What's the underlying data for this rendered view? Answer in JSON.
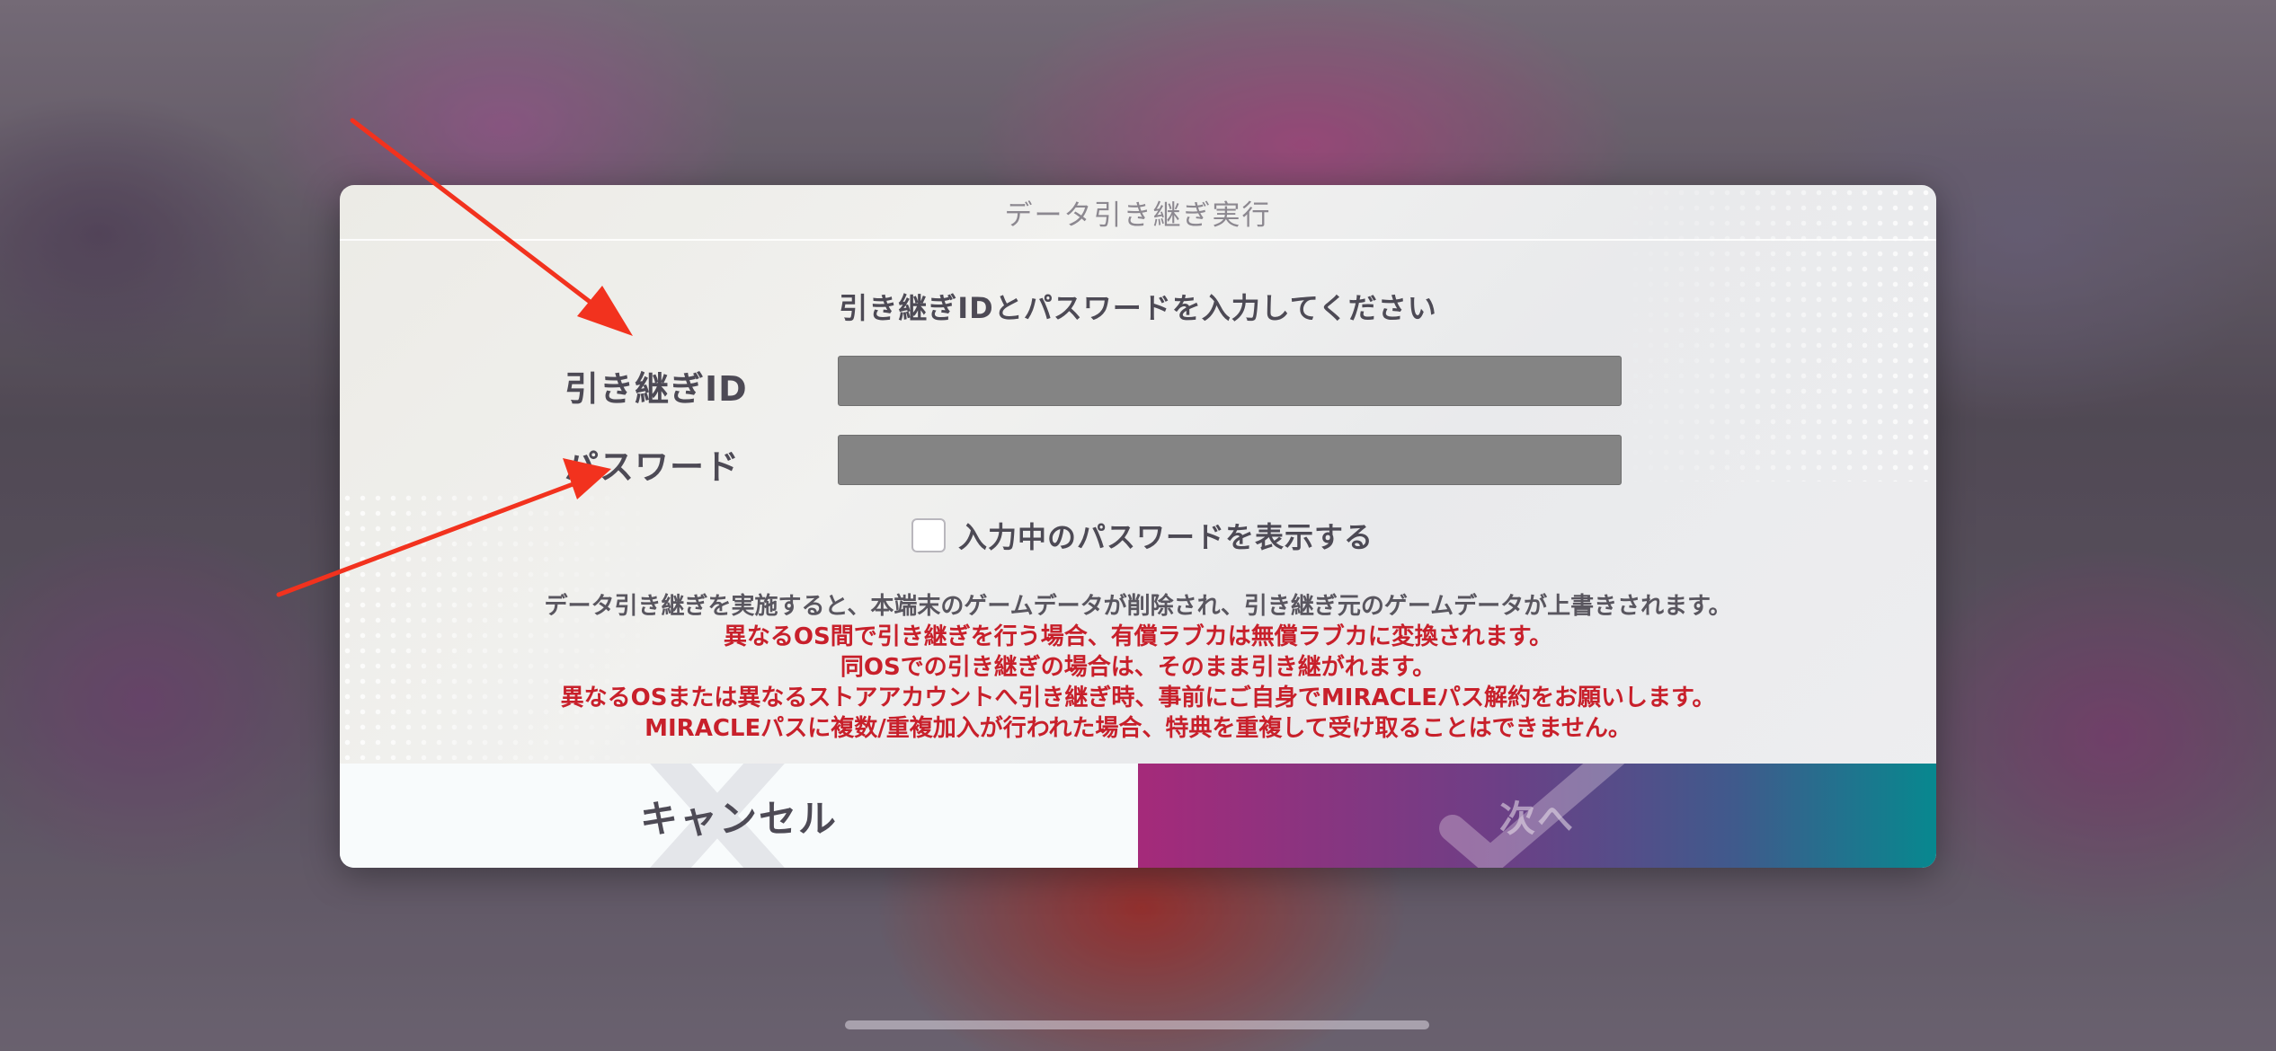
{
  "dialog": {
    "title": "データ引き継ぎ実行",
    "instruction": "引き継ぎIDとパスワードを入力してください",
    "fields": {
      "id_label": "引き継ぎID",
      "id_value": "",
      "password_label": "パスワード",
      "password_value": ""
    },
    "show_password": {
      "label": "入力中のパスワードを表示する",
      "checked": false
    },
    "notes": [
      "データ引き継ぎを実施すると、本端末のゲームデータが削除され、引き継ぎ元のゲームデータが上書きされます。",
      "異なるOS間で引き継ぎを行う場合、有償ラブカは無償ラブカに変換されます。",
      "同OSでの引き継ぎの場合は、そのまま引き継がれます。",
      "異なるOSまたは異なるストアアカウントへ引き継ぎ時、事前にご自身でMIRACLEパス解約をお願いします。",
      "MIRACLEパスに複数/重複加入が行われた場合、特典を重複して受け取ることはできません。"
    ],
    "buttons": {
      "cancel_label": "キャンセル",
      "next_label": "次へ"
    }
  },
  "icons": {
    "cancel_bg": "close-icon",
    "next_bg": "check-icon",
    "annotation": "arrow-icon"
  },
  "colors": {
    "note_red": "#c8202b",
    "annotation_arrow": "#f2321e",
    "input_bg": "#848484"
  }
}
